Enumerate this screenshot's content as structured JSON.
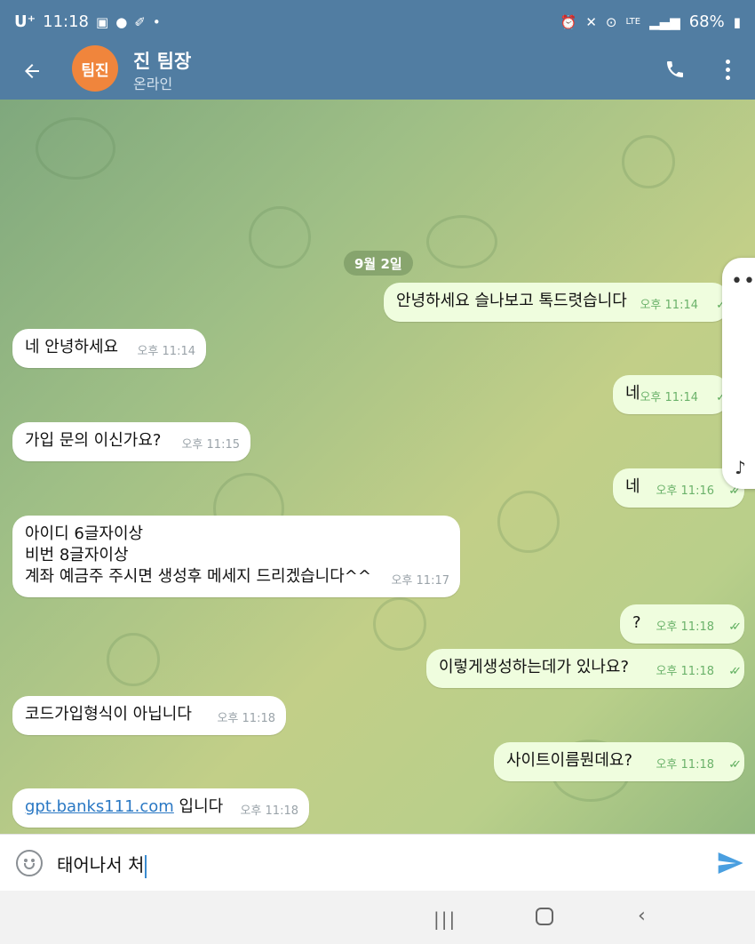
{
  "status_bar": {
    "carrier": "U⁺",
    "time": "11:18",
    "battery": "68%",
    "network": "LTE",
    "left_icons": [
      "image-icon",
      "talk-icon",
      "pill-icon",
      "dot-icon"
    ],
    "right_icons": [
      "alarm-icon",
      "mute-icon",
      "location-icon",
      "lte-icon",
      "signal-icon",
      "battery-icon"
    ]
  },
  "header": {
    "avatar_text": "팀진",
    "avatar_color": "#f0853c",
    "contact_name": "진 팀장",
    "contact_status": "온라인"
  },
  "chat": {
    "date_label": "9월 2일",
    "messages": [
      {
        "direction": "out",
        "text": "안녕하세요 슬나보고 톡드렷습니다",
        "time": "오후 11:14",
        "read": false
      },
      {
        "direction": "in",
        "text": "네 안녕하세요",
        "time": "오후 11:14"
      },
      {
        "direction": "out",
        "text": "네",
        "time": "오후 11:14",
        "read": false
      },
      {
        "direction": "in",
        "text": "가입 문의 이신가요?",
        "time": "오후 11:15"
      },
      {
        "direction": "out",
        "text": "네",
        "time": "오후 11:16",
        "read": true
      },
      {
        "direction": "in",
        "text": "아이디 6글자이상\n비번 8글자이상\n계좌 예금주 주시면 생성후 메세지 드리겠습니다^^",
        "time": "오후 11:17"
      },
      {
        "direction": "out",
        "text": "?",
        "time": "오후 11:18",
        "read": true
      },
      {
        "direction": "out",
        "text": "이렇게생성하는데가 있나요?",
        "time": "오후 11:18",
        "read": true
      },
      {
        "direction": "in",
        "text": "코드가입형식이 아닙니다",
        "time": "오후 11:18"
      },
      {
        "direction": "out",
        "text": "사이트이름뭔데요?",
        "time": "오후 11:18",
        "read": true
      },
      {
        "direction": "in",
        "link": "gpt.banks111.com",
        "text": " 입니다",
        "time": "오후 11:18"
      }
    ]
  },
  "input": {
    "value": "태어나서 처"
  },
  "colors": {
    "header": "#517da2",
    "outgoing_bubble": "#effdde",
    "incoming_bubble": "#ffffff",
    "accent": "#3a8bd0"
  }
}
